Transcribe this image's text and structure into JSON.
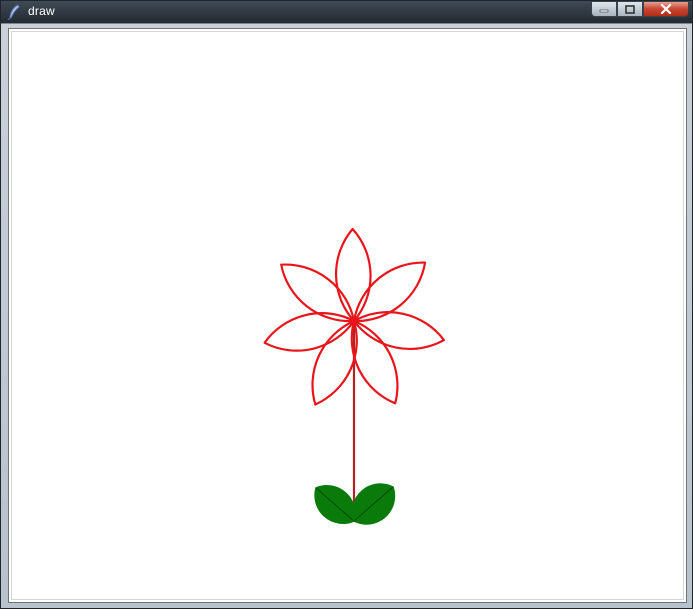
{
  "window": {
    "title": "draw",
    "icon": "feather-icon",
    "controls": [
      "minimize-icon",
      "maximize-icon",
      "close-icon"
    ]
  },
  "drawing": {
    "petal_color": "#e8151b",
    "stem_color": "#b22222",
    "leaf_color": "#0a7a0a",
    "leaf_vein_color": "#004d00",
    "petal_count": 7
  }
}
